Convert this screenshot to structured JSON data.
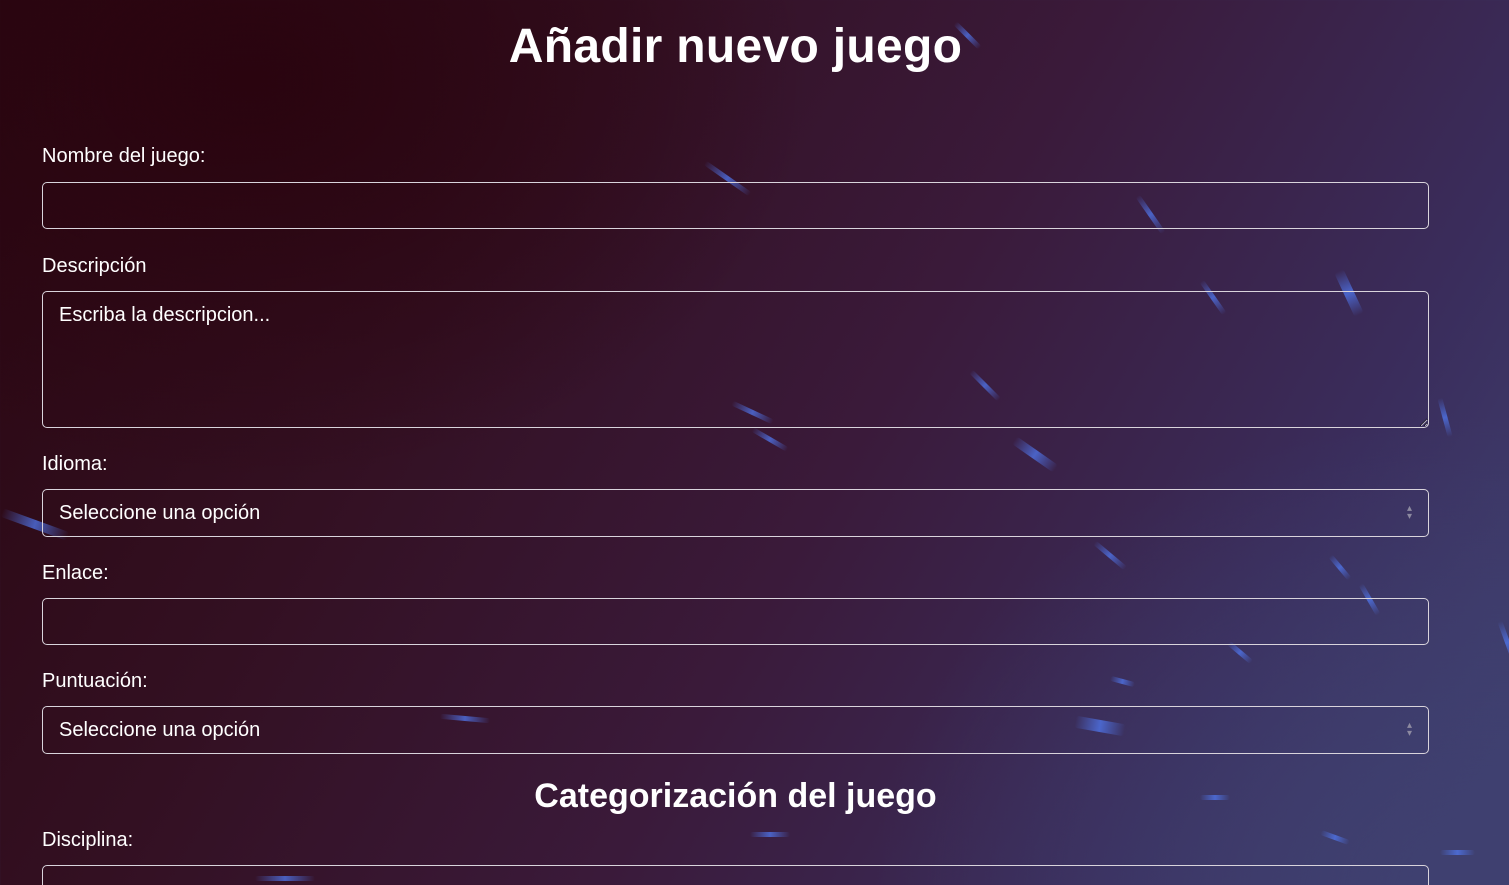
{
  "page": {
    "title": "Añadir nuevo juego",
    "section_title": "Categorización del juego"
  },
  "form": {
    "name": {
      "label": "Nombre del juego:",
      "value": ""
    },
    "description": {
      "label": "Descripción",
      "placeholder": "Escriba la descripcion..."
    },
    "language": {
      "label": "Idioma:",
      "selected": "Seleccione una opción"
    },
    "link": {
      "label": "Enlace:",
      "value": ""
    },
    "score": {
      "label": "Puntuación:",
      "selected": "Seleccione una opción"
    },
    "discipline": {
      "label": "Disciplina:",
      "value": ""
    }
  },
  "colors": {
    "text": "#ffffff",
    "border": "#d9d4dc",
    "bg_dark": "#2a0610",
    "bg_light": "#404474",
    "streak": "#5078f0"
  }
}
